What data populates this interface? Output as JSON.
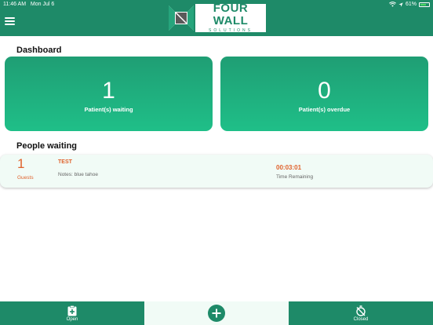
{
  "status_bar": {
    "time": "11:46 AM",
    "date": "Mon Jul 6",
    "battery": "61%"
  },
  "logo": {
    "title": "FOUR WALL",
    "subtitle": "SOLUTIONS"
  },
  "dashboard": {
    "title": "Dashboard",
    "cards": [
      {
        "value": "1",
        "label": "Patient(s) waiting"
      },
      {
        "value": "0",
        "label": "Patient(s) overdue"
      }
    ]
  },
  "people_waiting": {
    "title": "People waiting",
    "items": [
      {
        "count": "1",
        "count_label": "Guests",
        "name": "TEST",
        "notes": "Notes: blue tahoe",
        "timer": "00:03:01",
        "timer_label": "Time Remaining"
      }
    ]
  },
  "bottom_nav": {
    "open_label": "Open",
    "closed_label": "Closed"
  },
  "colors": {
    "brand_green": "#1e8a68",
    "card_gradient_top": "#1f9e74",
    "card_gradient_bottom": "#1fbf88",
    "accent_orange": "#e0622c",
    "row_background": "#f1fbf6"
  },
  "icons": {
    "menu": "hamburger-menu-icon",
    "wifi": "wifi-icon",
    "location": "location-arrow-icon",
    "battery": "battery-icon",
    "open": "clipboard-plus-icon",
    "add": "plus-circle-icon",
    "closed": "stopwatch-slash-icon"
  }
}
